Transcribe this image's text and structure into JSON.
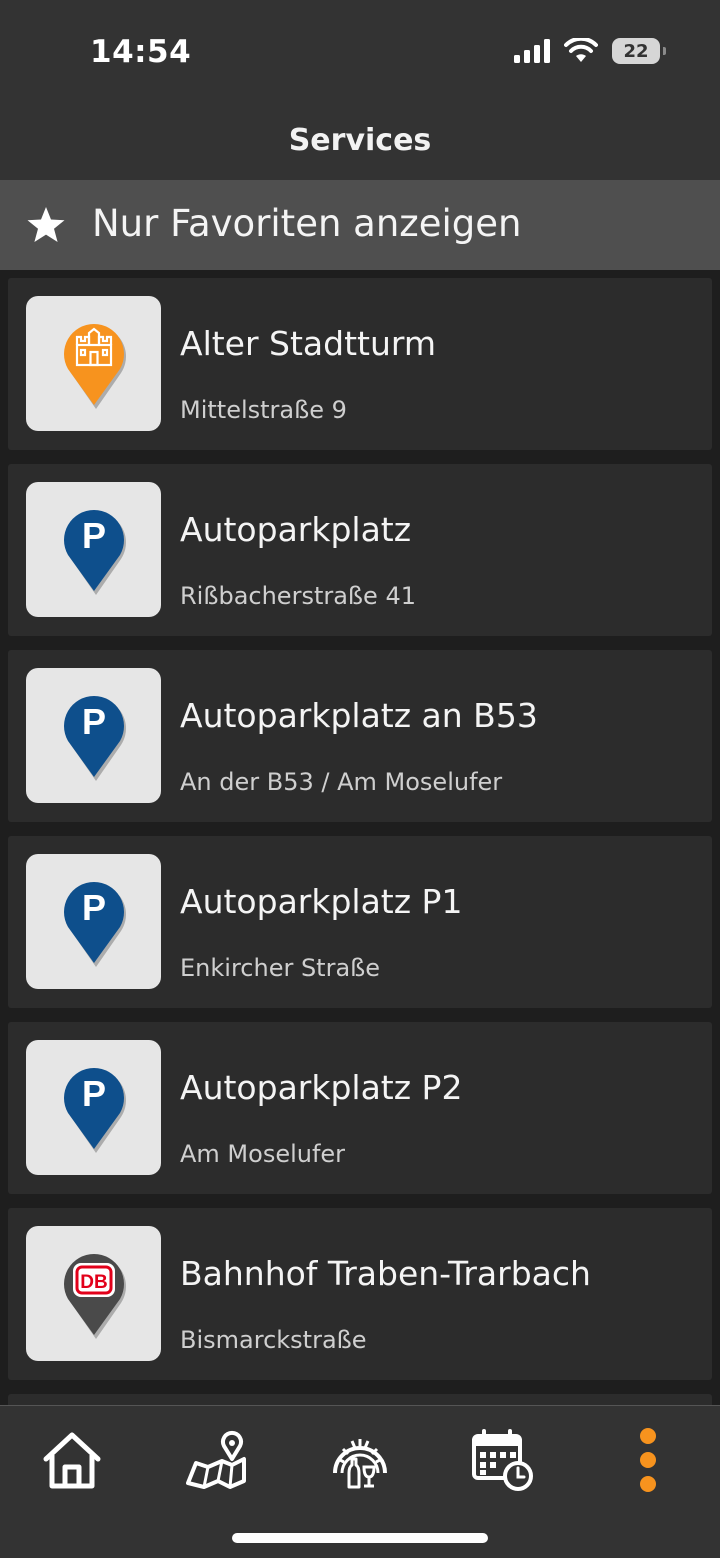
{
  "status": {
    "time": "14:54",
    "battery": "22"
  },
  "header": {
    "title": "Services"
  },
  "filter": {
    "label": "Nur Favoriten anzeigen",
    "icon": "star-icon"
  },
  "colors": {
    "accent": "#f7931e",
    "parking": "#0e4f8c",
    "station": "#4a4a4a",
    "db_red": "#e2001a"
  },
  "items": [
    {
      "title": "Alter Stadtturm",
      "subtitle": "Mittelstraße 9",
      "icon": "tower-pin-icon",
      "pin_color": "#f7931e",
      "pin_text": ""
    },
    {
      "title": "Autoparkplatz",
      "subtitle": "Rißbacherstraße 41",
      "icon": "parking-pin-icon",
      "pin_color": "#0e4f8c",
      "pin_text": "P"
    },
    {
      "title": "Autoparkplatz an B53",
      "subtitle": "An der B53 / Am Moselufer",
      "icon": "parking-pin-icon",
      "pin_color": "#0e4f8c",
      "pin_text": "P"
    },
    {
      "title": "Autoparkplatz P1",
      "subtitle": "Enkircher Straße",
      "icon": "parking-pin-icon",
      "pin_color": "#0e4f8c",
      "pin_text": "P"
    },
    {
      "title": "Autoparkplatz P2",
      "subtitle": "Am Moselufer",
      "icon": "parking-pin-icon",
      "pin_color": "#0e4f8c",
      "pin_text": "P"
    },
    {
      "title": "Bahnhof Traben-Trarbach",
      "subtitle": "Bismarckstraße",
      "icon": "db-station-pin-icon",
      "pin_color": "#4a4a4a",
      "pin_text": "DB"
    }
  ],
  "tabs": [
    {
      "name": "home-icon"
    },
    {
      "name": "map-icon"
    },
    {
      "name": "wine-cellar-icon"
    },
    {
      "name": "calendar-icon"
    },
    {
      "name": "more-icon"
    }
  ]
}
